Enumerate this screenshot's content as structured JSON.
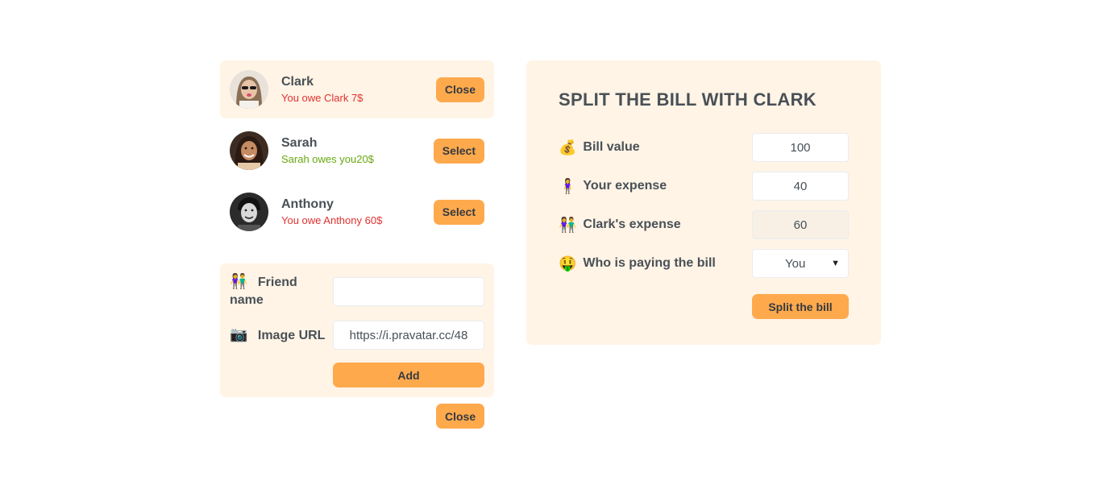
{
  "friends": [
    {
      "name": "Clark",
      "balance": "You owe Clark 7$",
      "balance_type": "owe",
      "button": "Close",
      "selected": true
    },
    {
      "name": "Sarah",
      "balance": "Sarah owes you20$",
      "balance_type": "owed",
      "button": "Select",
      "selected": false
    },
    {
      "name": "Anthony",
      "balance": "You owe Anthony 60$",
      "balance_type": "owe",
      "button": "Select",
      "selected": false
    }
  ],
  "add_form": {
    "friend_name_icon": "👫",
    "friend_name_label": "Friend name",
    "friend_name_value": "",
    "image_url_icon": "📷",
    "image_url_label": "Image URL",
    "image_url_value": "https://i.pravatar.cc/48",
    "add_button": "Add"
  },
  "close_button": "Close",
  "split": {
    "title": "SPLIT THE BILL WITH CLARK",
    "bill_icon": "💰",
    "bill_label": "Bill value",
    "bill_value": "100",
    "your_icon": "🧍‍♀️",
    "your_label": "Your expense",
    "your_value": "40",
    "friend_icon": "👫",
    "friend_label": "Clark's expense",
    "friend_value": "60",
    "payer_icon": "🤑",
    "payer_label": "Who is paying the bill",
    "payer_value": "You",
    "split_button": "Split the bill"
  },
  "colors": {
    "accent": "#ffa94d",
    "panel": "#fff4e6",
    "red": "#e03131",
    "green": "#66a80f"
  }
}
